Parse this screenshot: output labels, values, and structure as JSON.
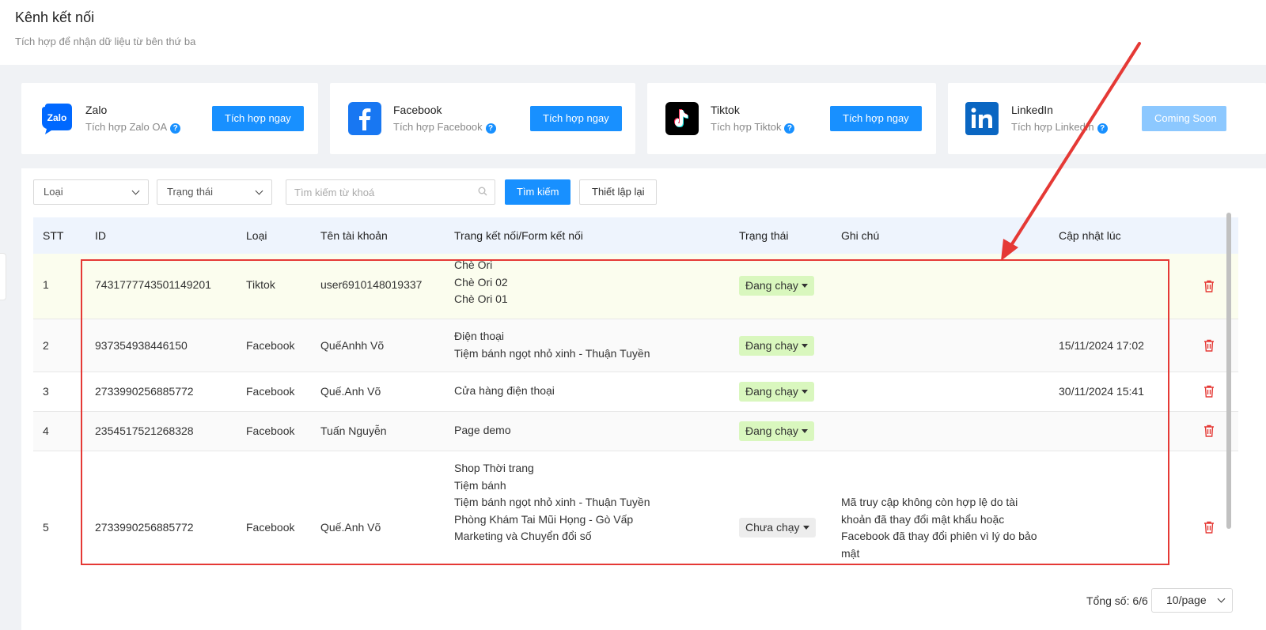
{
  "header": {
    "title": "Kênh kết nối",
    "subtitle": "Tích hợp để nhận dữ liệu từ bên thứ ba"
  },
  "integrations": [
    {
      "name": "Zalo",
      "desc": "Tích hợp Zalo OA",
      "button": "Tích hợp ngay",
      "color": "#0068ff"
    },
    {
      "name": "Facebook",
      "desc": "Tích hợp Facebook",
      "button": "Tích hợp ngay",
      "color": "#1877f2"
    },
    {
      "name": "Tiktok",
      "desc": "Tích hợp Tiktok",
      "button": "Tích hợp ngay",
      "color": "#000000"
    },
    {
      "name": "LinkedIn",
      "desc": "Tích hợp LinkedIn",
      "button": "Coming Soon",
      "color": "#0a66c2"
    }
  ],
  "filters": {
    "type_placeholder": "Loại",
    "status_placeholder": "Trạng thái",
    "search_placeholder": "Tìm kiếm từ khoá",
    "search_button": "Tìm kiếm",
    "reset_button": "Thiết lập lại"
  },
  "table": {
    "columns": [
      "STT",
      "ID",
      "Loại",
      "Tên tài khoản",
      "Trang kết nối/Form kết nối",
      "Trạng thái",
      "Ghi chú",
      "Cập nhật lúc"
    ],
    "rows": [
      {
        "stt": "1",
        "id": "7431777743501149201",
        "type": "Tiktok",
        "account": "user6910148019337",
        "pages": [
          "Chè Ori",
          "Chè Ori 02",
          "Chè Ori 01"
        ],
        "status": "Đang chạy",
        "note": [],
        "updated": ""
      },
      {
        "stt": "2",
        "id": "937354938446150",
        "type": "Facebook",
        "account": "QuếAnhh Võ",
        "pages": [
          "Điện thoại",
          "Tiệm bánh ngọt nhỏ xinh - Thuận Tuyền"
        ],
        "status": "Đang chạy",
        "note": [],
        "updated": "15/11/2024 17:02"
      },
      {
        "stt": "3",
        "id": "2733990256885772",
        "type": "Facebook",
        "account": "Quế.Anh Võ",
        "pages": [
          "Cửa hàng điện thoại"
        ],
        "status": "Đang chạy",
        "note": [],
        "updated": "30/11/2024 15:41"
      },
      {
        "stt": "4",
        "id": "2354517521268328",
        "type": "Facebook",
        "account": "Tuấn Nguyễn",
        "pages": [
          "Page demo"
        ],
        "status": "Đang chạy",
        "note": [],
        "updated": ""
      },
      {
        "stt": "5",
        "id": "2733990256885772",
        "type": "Facebook",
        "account": "Quế.Anh Võ",
        "pages": [
          "Shop Thời trang",
          "Tiệm bánh",
          "Tiệm bánh ngọt nhỏ xinh - Thuận Tuyền",
          "Phòng Khám Tai Mũi Họng - Gò Vấp",
          "Marketing và Chuyển đổi số"
        ],
        "status": "Chưa chạy",
        "note": [
          "Mã truy cập không còn hợp lệ do tài",
          "khoản đã thay đổi mật khẩu hoặc",
          "Facebook đã thay đổi phiên vì lý do bảo",
          "mật"
        ],
        "updated": ""
      }
    ]
  },
  "footer": {
    "total": "Tổng số: 6/6",
    "page_size": "10/page"
  },
  "colors": {
    "primary": "#1890ff",
    "running_tag": "#d9f7be",
    "highlight": "#e53935",
    "delete": "#e53935"
  }
}
